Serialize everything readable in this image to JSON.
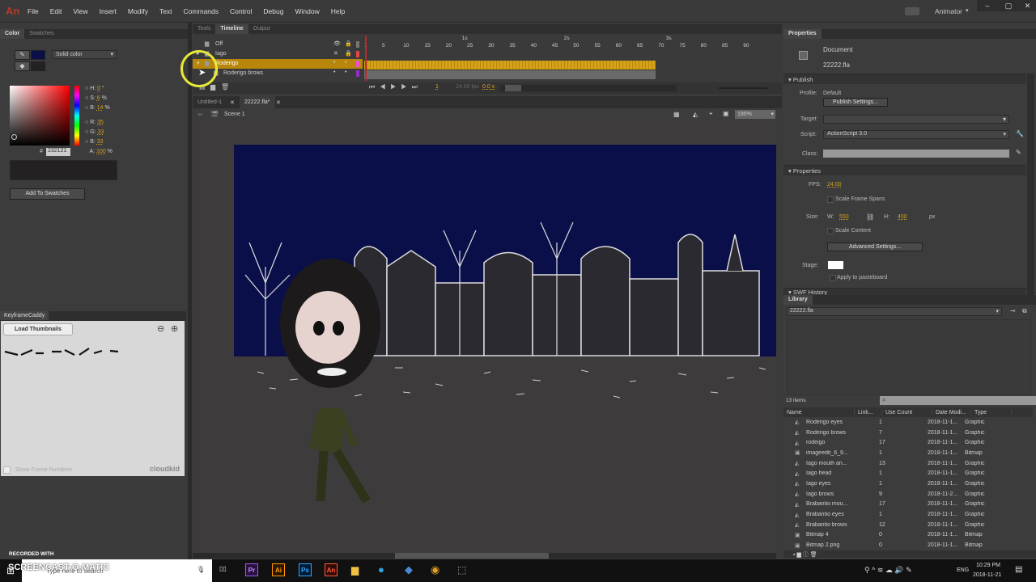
{
  "app": {
    "logo": "An",
    "menu": [
      "File",
      "Edit",
      "View",
      "Insert",
      "Modify",
      "Text",
      "Commands",
      "Control",
      "Debug",
      "Window",
      "Help"
    ],
    "workspace": "Animator"
  },
  "color_panel": {
    "tabs": [
      "Color",
      "Swatches"
    ],
    "fill_type": "Solid color",
    "h": "0",
    "h_unit": "°",
    "s": "6",
    "s_unit": "%",
    "b": "14",
    "b_unit": "%",
    "r": "35",
    "g": "33",
    "bl": "33",
    "a": "100",
    "a_unit": "%",
    "hex": "232121",
    "add_label": "Add To Swatches",
    "labels": {
      "h": "H:",
      "s": "S:",
      "b": "B:",
      "r": "R:",
      "g": "G:",
      "bl": "B:",
      "a": "A:",
      "hash": "#"
    }
  },
  "keyframe_caddy": {
    "title": "KeyframeCaddy",
    "load": "Load Thumbnails",
    "show_frames": "Show Frame Numbers",
    "brand": "cloudkid"
  },
  "timeline": {
    "tabs": [
      "Tools",
      "Timeline",
      "Output"
    ],
    "layers": [
      {
        "name": "Off"
      },
      {
        "name": "Iago"
      },
      {
        "name": "Roderigo"
      },
      {
        "name": "Roderigo brows"
      }
    ],
    "ruler": [
      "1",
      "5",
      "10",
      "15",
      "20",
      "25",
      "30",
      "35",
      "40",
      "45",
      "50",
      "55",
      "60",
      "65",
      "70",
      "75",
      "80",
      "85",
      "90"
    ],
    "seconds": [
      "1s",
      "2s",
      "3s"
    ],
    "current_frame": "1",
    "fps": "24.00 fps",
    "time": "0.0 s"
  },
  "document": {
    "tabs": [
      "Untitled-1",
      "22222.fla*"
    ],
    "scene": "Scene 1",
    "zoom": "195%",
    "stage_sky": "#0a0f4a",
    "stage_ground": "#3e3b3c"
  },
  "properties": {
    "title": "Properties",
    "doc_label": "Document",
    "doc_name": "22222.fla",
    "publish": "Publish",
    "profile_label": "Profile:",
    "profile": "Default",
    "publish_settings": "Publish Settings...",
    "target_label": "Target:",
    "script_label": "Script:",
    "script": "ActionScript 3.0",
    "class_label": "Class:",
    "props": "Properties",
    "fps_label": "FPS:",
    "fps": "24.00",
    "scale_spans": "Scale Frame Spans",
    "size_label": "Size:",
    "w_label": "W:",
    "w": "550",
    "h_label": "H:",
    "h": "400",
    "px": "px",
    "scale_content": "Scale Content",
    "advanced": "Advanced Settings...",
    "stage_label": "Stage:",
    "apply_paste": "Apply to pasteboard",
    "swf_history": "SWF History"
  },
  "library": {
    "title": "Library",
    "file": "22222.fla",
    "count": "13 items",
    "columns": [
      "Name",
      "Link...",
      "Use Count",
      "Date Modi...",
      "Type"
    ],
    "items": [
      {
        "name": "Roderigo eyes",
        "count": "1",
        "date": "2018-11-1...",
        "type": "Graphic"
      },
      {
        "name": "Roderigo brows",
        "count": "7",
        "date": "2018-11-1...",
        "type": "Graphic"
      },
      {
        "name": "rodeigo",
        "count": "17",
        "date": "2018-11-1...",
        "type": "Graphic"
      },
      {
        "name": "imageedit_6_9...",
        "count": "1",
        "date": "2018-11-1...",
        "type": "Bitmap"
      },
      {
        "name": "Iago mouth an...",
        "count": "13",
        "date": "2018-11-1...",
        "type": "Graphic"
      },
      {
        "name": "Iago head",
        "count": "1",
        "date": "2018-11-1...",
        "type": "Graphic"
      },
      {
        "name": "Iago eyes",
        "count": "1",
        "date": "2018-11-1...",
        "type": "Graphic"
      },
      {
        "name": "Iago brows",
        "count": "9",
        "date": "2018-11-2...",
        "type": "Graphic"
      },
      {
        "name": "Brabantio mou...",
        "count": "17",
        "date": "2018-11-1...",
        "type": "Graphic"
      },
      {
        "name": "Brabantio eyes",
        "count": "1",
        "date": "2018-11-1...",
        "type": "Graphic"
      },
      {
        "name": "Brabantio brows",
        "count": "12",
        "date": "2018-11-1...",
        "type": "Graphic"
      },
      {
        "name": "Bitmap 4",
        "count": "0",
        "date": "2018-11-1...",
        "type": "Bitmap"
      },
      {
        "name": "Bitmap 2.png",
        "count": "0",
        "date": "2018-11-1...",
        "type": "Bitmap"
      }
    ]
  },
  "taskbar": {
    "search": "Type here to search",
    "watermark_top": "RECORDED WITH",
    "watermark": "SCREENCAST-O-MATIC",
    "lang": "ENG",
    "time": "10:29 PM",
    "date": "2018-11-21",
    "apps": [
      "Pr",
      "Ai",
      "Ps",
      "An"
    ]
  }
}
